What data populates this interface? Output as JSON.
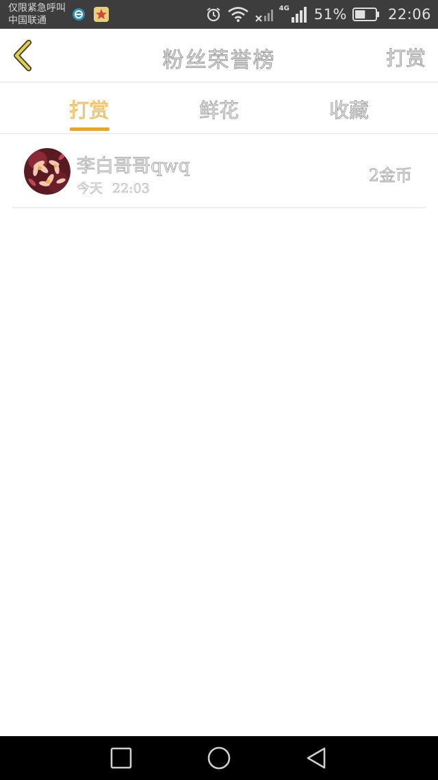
{
  "status_bar": {
    "carrier_line1": "仅限紧急呼叫",
    "carrier_line2": "中国联通",
    "network_type": "4G",
    "battery_percent": "51%",
    "battery_level": 0.51,
    "time": "22:06"
  },
  "nav": {
    "title": "粉丝荣誉榜",
    "action_label": "打赏"
  },
  "tabs": [
    {
      "label": "打赏",
      "active": true
    },
    {
      "label": "鲜花",
      "active": false
    },
    {
      "label": "收藏",
      "active": false
    }
  ],
  "list": [
    {
      "name": "李白哥哥qwq",
      "date": "今天",
      "time": "22:03",
      "amount": "2金币"
    }
  ],
  "colors": {
    "accent": "#f1a31e",
    "status_bar": "#3d3d3d",
    "back_arrow": "#d9c24a"
  }
}
